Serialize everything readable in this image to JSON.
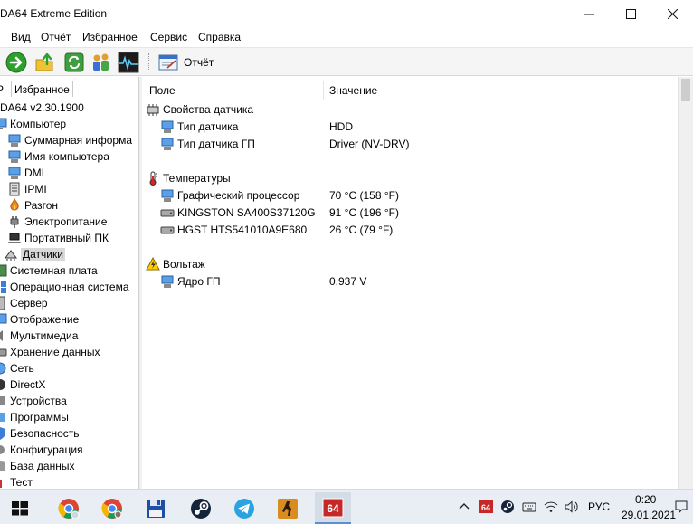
{
  "window": {
    "title": "DA64 Extreme Edition"
  },
  "menu": [
    "Вид",
    "Отчёт",
    "Избранное",
    "Сервис",
    "Справка"
  ],
  "toolbar": {
    "report_label": "Отчёт"
  },
  "left_tabs": [
    "Избранное"
  ],
  "tree": [
    {
      "label": "DA64 v2.30.1900"
    },
    {
      "label": "Компьютер"
    },
    {
      "label": "Суммарная информа"
    },
    {
      "label": "Имя компьютера"
    },
    {
      "label": "DMI"
    },
    {
      "label": "IPMI"
    },
    {
      "label": "Разгон"
    },
    {
      "label": "Электропитание"
    },
    {
      "label": "Портативный ПК"
    },
    {
      "label": "Датчики"
    },
    {
      "label": "Системная плата"
    },
    {
      "label": "Операционная система"
    },
    {
      "label": "Сервер"
    },
    {
      "label": "Отображение"
    },
    {
      "label": "Мультимедиа"
    },
    {
      "label": "Хранение данных"
    },
    {
      "label": "Сеть"
    },
    {
      "label": "DirectX"
    },
    {
      "label": "Устройства"
    },
    {
      "label": "Программы"
    },
    {
      "label": "Безопасность"
    },
    {
      "label": "Конфигурация"
    },
    {
      "label": "База данных"
    },
    {
      "label": "Тест"
    }
  ],
  "columns": {
    "field": "Поле",
    "value": "Значение"
  },
  "groups": [
    {
      "title": "Свойства датчика",
      "rows": [
        {
          "field": "Тип датчика",
          "value": "HDD"
        },
        {
          "field": "Тип датчика ГП",
          "value": "Driver  (NV-DRV)"
        }
      ]
    },
    {
      "title": "Температуры",
      "rows": [
        {
          "field": "Графический процессор",
          "value": "70 °C  (158 °F)"
        },
        {
          "field": "KINGSTON SA400S37120G",
          "value": "91 °C  (196 °F)"
        },
        {
          "field": "HGST HTS541010A9E680",
          "value": "26 °C  (79 °F)"
        }
      ]
    },
    {
      "title": "Вольтаж",
      "rows": [
        {
          "field": "Ядро ГП",
          "value": "0.937 V"
        }
      ]
    }
  ],
  "taskbar": {
    "lang": "РУС",
    "time": "0:20",
    "date": "29.01.2021",
    "app_badge": "64"
  },
  "colors": {
    "accent": "#5b8fd0",
    "selection": "#d9d9d9",
    "taskbar": "#e8eef4"
  }
}
